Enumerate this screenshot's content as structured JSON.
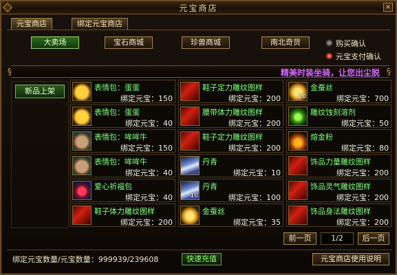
{
  "window": {
    "title": "元宝商店",
    "close_label": "×"
  },
  "tabs": [
    {
      "label": "元宝商店"
    },
    {
      "label": "绑定元宝商店"
    }
  ],
  "categories": [
    {
      "label": "大卖场"
    },
    {
      "label": "宝石商城"
    },
    {
      "label": "珍兽商城"
    },
    {
      "label": "南北奇货"
    }
  ],
  "options": [
    {
      "label": "购买确认"
    },
    {
      "label": "元宝支付确认"
    }
  ],
  "marquee": {
    "text": "精美时装坐骑，让您出尘脱"
  },
  "left_panel": {
    "new_items_label": "新品上架"
  },
  "items": [
    {
      "name": "表情包：蛋蛋",
      "price": "绑定元宝：150",
      "icon": "chick-emoticon-icon"
    },
    {
      "name": "鞋子定力雕纹图样",
      "price": "绑定元宝：200",
      "icon": "red-scroll-icon"
    },
    {
      "name": "金蚕丝",
      "price": "绑定元宝：700",
      "icon": "gold-silk-icon",
      "qty": "20"
    },
    {
      "name": "表情包：蛋蛋",
      "price": "绑定元宝：40",
      "icon": "chick-emoticon-icon"
    },
    {
      "name": "腰带体力雕纹图样",
      "price": "绑定元宝：200",
      "icon": "red-scroll-icon"
    },
    {
      "name": "雕纹蚀刻溶剂",
      "price": "绑定元宝：50",
      "icon": "sprout-icon"
    },
    {
      "name": "表情包：哞哞牛",
      "price": "绑定元宝：150",
      "icon": "cow-emoticon-icon"
    },
    {
      "name": "鞋子定力雕纹图样",
      "price": "绑定元宝：200",
      "icon": "red-scroll-icon"
    },
    {
      "name": "熔金粉",
      "price": "绑定元宝：80",
      "icon": "gold-powder-icon"
    },
    {
      "name": "表情包：哞哞牛",
      "price": "绑定元宝：40",
      "icon": "cow-emoticon-icon"
    },
    {
      "name": "丹青",
      "price": "绑定元宝：10",
      "icon": "cloth-dye-icon"
    },
    {
      "name": "饰品力量雕纹图样",
      "price": "绑定元宝：200",
      "icon": "red-scroll-icon"
    },
    {
      "name": "爱心祈福包",
      "price": "绑定元宝：40",
      "icon": "heart-pack-icon"
    },
    {
      "name": "丹青",
      "price": "绑定元宝：100",
      "icon": "cloth-dye-icon",
      "qty": "10"
    },
    {
      "name": "饰品灵气雕纹图样",
      "price": "绑定元宝：200",
      "icon": "red-scroll-icon"
    },
    {
      "name": "鞋子体力雕纹图样",
      "price": "绑定元宝：200",
      "icon": "red-scroll-icon"
    },
    {
      "name": "金蚕丝",
      "price": "绑定元宝：35",
      "icon": "gold-silk-icon"
    },
    {
      "name": "饰品身法雕纹图样",
      "price": "绑定元宝：200",
      "icon": "red-scroll-icon"
    }
  ],
  "pagination": {
    "prev_label": "前一页",
    "page_text": "1/2",
    "next_label": "后一页"
  },
  "footer": {
    "balance_text": "绑定元宝数量/元宝数量：999939/239608",
    "recharge_label": "快速充值",
    "help_label": "元宝商店使用说明"
  }
}
